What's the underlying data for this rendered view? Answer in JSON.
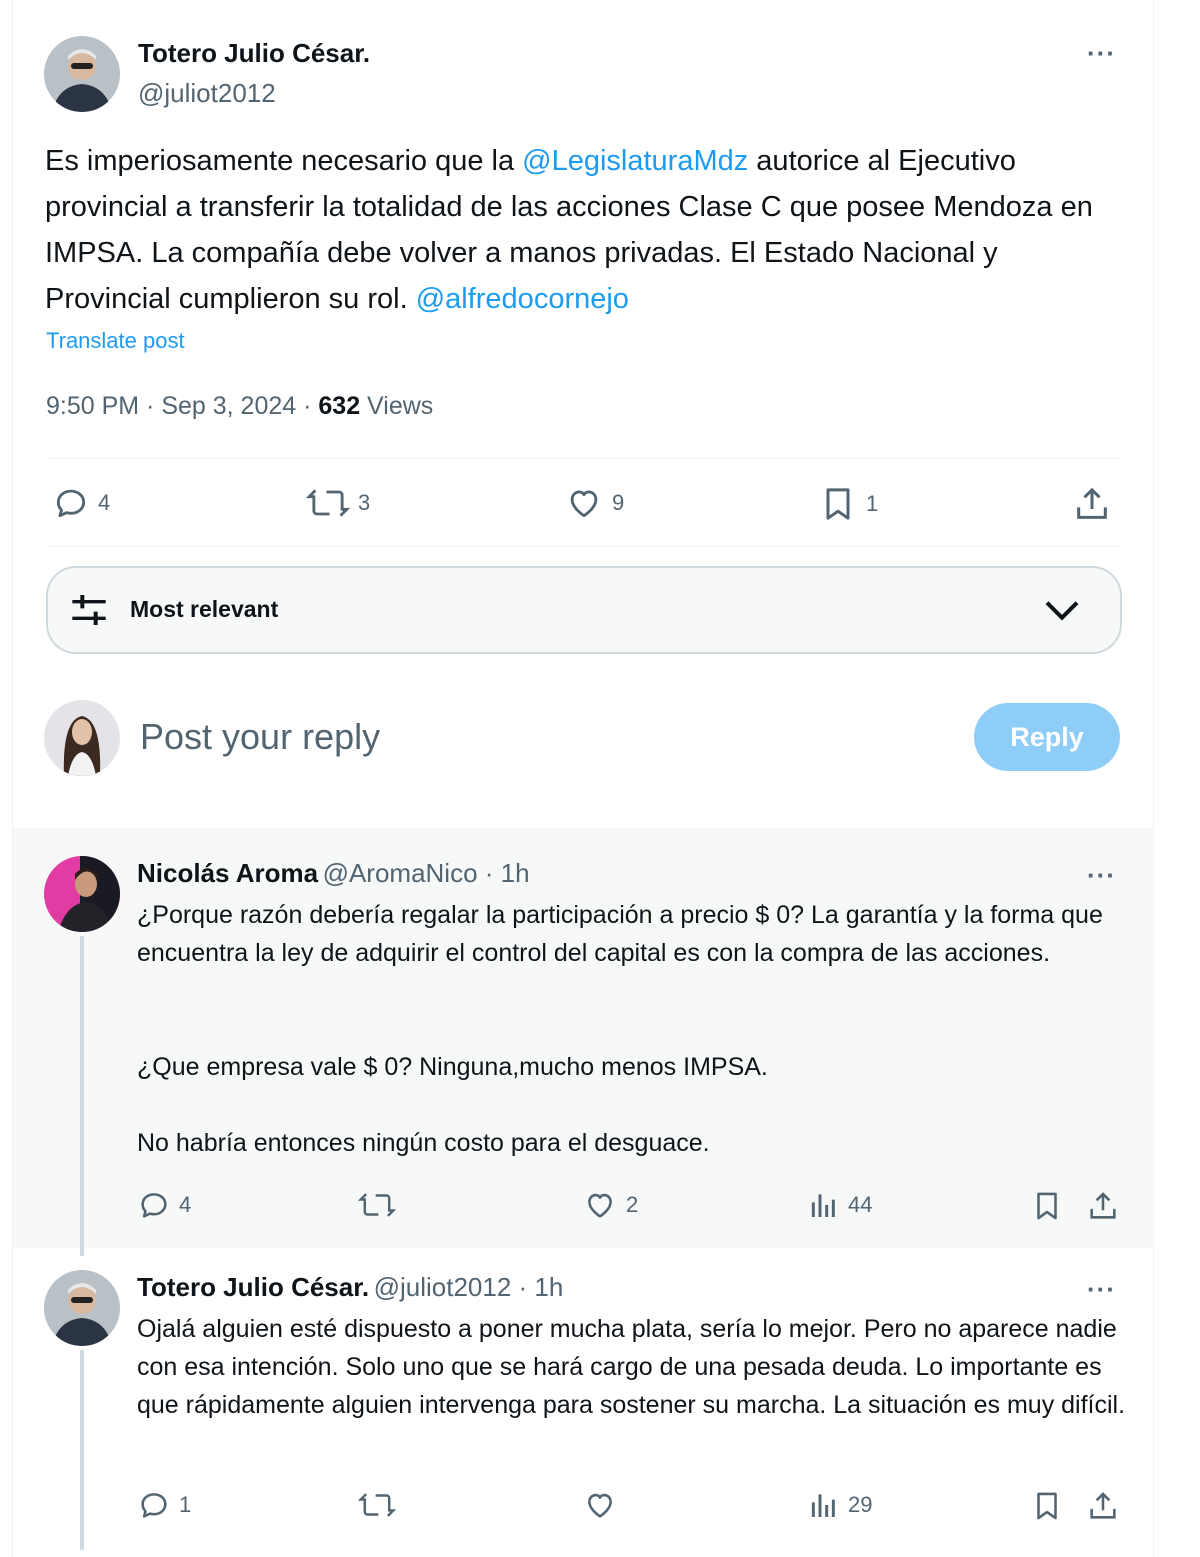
{
  "post": {
    "author_name": "Totero Julio César.",
    "author_handle": "@juliot2012",
    "text_1": "Es imperiosamente necesario que la ",
    "mention_1": "@LegislaturaMdz",
    "text_2": "  autorice al Ejecutivo provincial a transferir la totalidad de las acciones Clase C que posee Mendoza en IMPSA.  La compañía debe volver a manos privadas. El Estado Nacional y Provincial cumplieron su rol. ",
    "mention_2": "@alfredocornejo",
    "translate": "Translate post",
    "timestamp": "9:50 PM · Sep 3, 2024 · ",
    "views_count": "632",
    "views_label": " Views",
    "stats": {
      "replies": "4",
      "reposts": "3",
      "likes": "9",
      "bookmarks": "1"
    }
  },
  "sort": {
    "label": "Most relevant"
  },
  "composer": {
    "placeholder": "Post your reply",
    "reply_button": "Reply"
  },
  "comments": [
    {
      "author_name": "Nicolás Aroma",
      "author_handle": "@AromaNico",
      "time": " · 1h",
      "paragraphs": [
        "¿Porque razón debería regalar la participación a precio $ 0? La garantía y la forma que encuentra la ley de adquirir el control del capital es con la compra de las acciones.",
        "¿Que empresa vale $ 0? Ninguna,mucho menos IMPSA.",
        "No habría entonces ningún costo para el desguace."
      ],
      "stats": {
        "replies": "4",
        "reposts": "",
        "likes": "2",
        "views": "44"
      }
    },
    {
      "author_name": "Totero Julio César.",
      "author_handle": "@juliot2012",
      "time": " · 1h",
      "paragraphs": [
        "Ojalá alguien esté dispuesto a poner mucha plata, sería lo mejor. Pero no aparece nadie con esa intención. Solo uno que se hará cargo de una pesada deuda. Lo importante es que rápidamente alguien intervenga para sostener su marcha. La situación es muy difícil."
      ],
      "stats": {
        "replies": "1",
        "reposts": "",
        "likes": "",
        "views": "29"
      }
    }
  ],
  "more_glyph": "···",
  "colors": {
    "accent": "#1d9bf0",
    "secondary_text": "#536471",
    "reply_button": "#8ecdf8"
  }
}
